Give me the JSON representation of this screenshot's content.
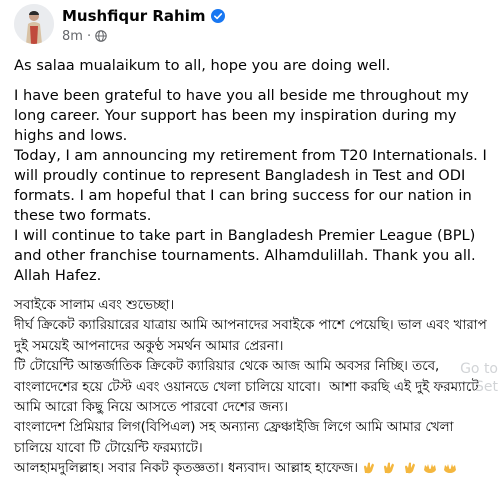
{
  "post": {
    "author": "Mushfiqur Rahim",
    "timestamp": "8m",
    "separator": "·",
    "verified": true,
    "english_paragraphs": [
      "As salaa mualaikum to all, hope you are doing well.",
      "I have been grateful to have you all beside me throughout my long career. Your support has been my inspiration during my highs and lows.\nToday, I am announcing my retirement from T20 Internationals. I will proudly continue to represent Bangladesh in Test and ODI formats. I am hopeful that I can bring success for our nation in these two formats.\nI will continue to take part in Bangladesh Premier League (BPL) and other franchise tournaments. Alhamdulillah. Thank you all. Allah Hafez."
    ],
    "bangla_lines": [
      "সবাইকে সালাম এবং শুভেচ্ছা।",
      "দীর্ঘ ক্রিকেট ক্যারিয়ারের যাত্রায় আমি আপনাদের সবাইকে পাশে পেয়েছি। ভাল এবং খারাপ দুই সময়েই আপনাদের অকুণ্ঠ সমর্থন আমার প্রেরনা।",
      "টি টোয়েন্টি আন্তর্জাতিক ক্রিকেট ক্যারিয়ার থেকে আজ আমি অবসর নিচ্ছি। তবে, বাংলাদেশের হয়ে টেস্ট এবং ওয়ানডে খেলা চালিয়ে যাবো।  আশা করছি এই দুই ফরম্যাটে আমি আরো কিছু নিয়ে আসতে পারবো দেশের জন্য।",
      "বাংলাদেশ প্রিমিয়ার লিগ(বিপিএল) সহ অন্যান্য ফ্রেঞ্চাইজি লিগে আমি আমার খেলা চালিয়ে যাবো টি টোয়েন্টি ফরম্যাটে।",
      "আলহামদুলিল্লাহ। সবার নিকট কৃতজ্ঞতা। ধন্যবাদ। আল্লাহ হাফেজ।"
    ],
    "closing_emojis": [
      "clapping-hands",
      "clapping-hands",
      "clapping-hands",
      "open-hands",
      "open-hands"
    ]
  },
  "watermark": "Go to Set",
  "colors": {
    "text": "#050505",
    "meta": "#65676b",
    "verified": "#1877f2",
    "emoji": "#f4b73f"
  }
}
